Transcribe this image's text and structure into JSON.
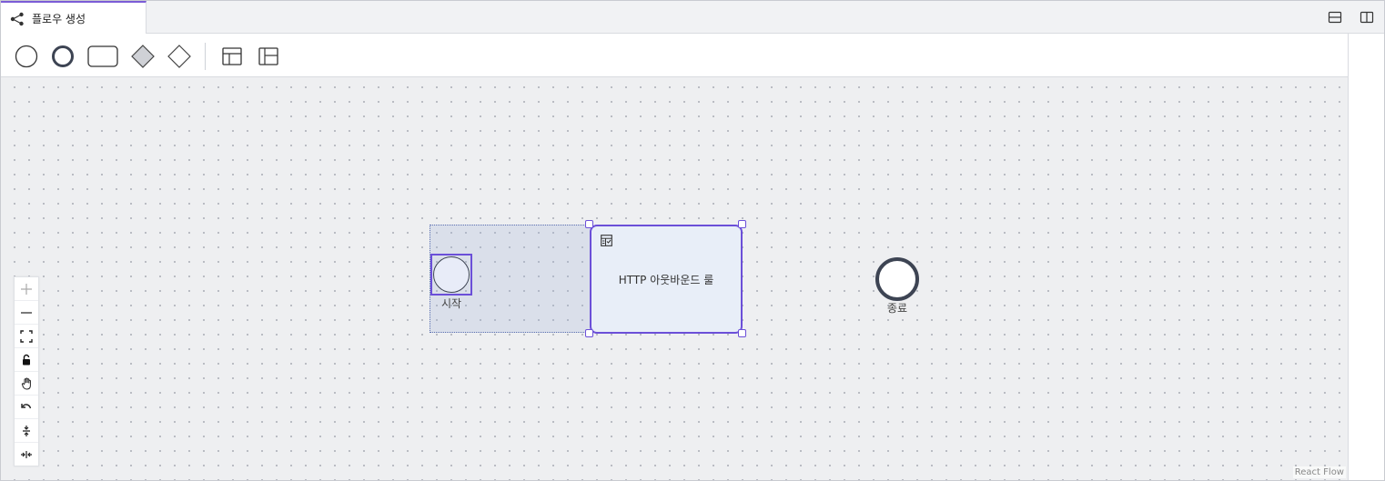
{
  "tab": {
    "title": "플로우 생성",
    "icon": "flow-share-icon"
  },
  "header_actions": [
    {
      "name": "split-horizontal-button",
      "icon": "split-horizontal-icon"
    },
    {
      "name": "split-vertical-button",
      "icon": "split-vertical-icon"
    }
  ],
  "toolbar": {
    "tools": [
      {
        "name": "start-event-tool",
        "icon": "thin-circle-icon"
      },
      {
        "name": "end-event-tool",
        "icon": "thick-circle-icon"
      },
      {
        "name": "task-tool",
        "icon": "rounded-rectangle-icon"
      },
      {
        "name": "exclusive-gateway-tool",
        "icon": "filled-diamond-icon"
      },
      {
        "name": "gateway-tool",
        "icon": "outline-diamond-icon"
      },
      {
        "name": "pool-horizontal-tool",
        "icon": "table-horizontal-icon"
      },
      {
        "name": "pool-vertical-tool",
        "icon": "table-vertical-icon"
      }
    ]
  },
  "canvas": {
    "nodes": {
      "start": {
        "label": "시작"
      },
      "task": {
        "label": "HTTP 아웃바운드 룰",
        "icon": "rule-table-icon"
      },
      "end": {
        "label": "종료"
      }
    },
    "attribution": "React Flow"
  },
  "controls": [
    {
      "name": "zoom-in-button",
      "icon": "plus-icon"
    },
    {
      "name": "zoom-out-button",
      "icon": "minus-icon"
    },
    {
      "name": "fit-view-button",
      "icon": "fit-view-icon"
    },
    {
      "name": "lock-button",
      "icon": "lock-icon"
    },
    {
      "name": "pan-hand-button",
      "icon": "hand-icon"
    },
    {
      "name": "undo-button",
      "icon": "undo-icon"
    },
    {
      "name": "align-vertical-button",
      "icon": "align-vertical-icon"
    },
    {
      "name": "align-horizontal-button",
      "icon": "align-horizontal-icon"
    }
  ],
  "colors": {
    "accent": "#6b4fd8",
    "node_stroke": "#3d4453",
    "canvas_bg": "#eeeff1",
    "node_fill": "#e8eef8"
  }
}
